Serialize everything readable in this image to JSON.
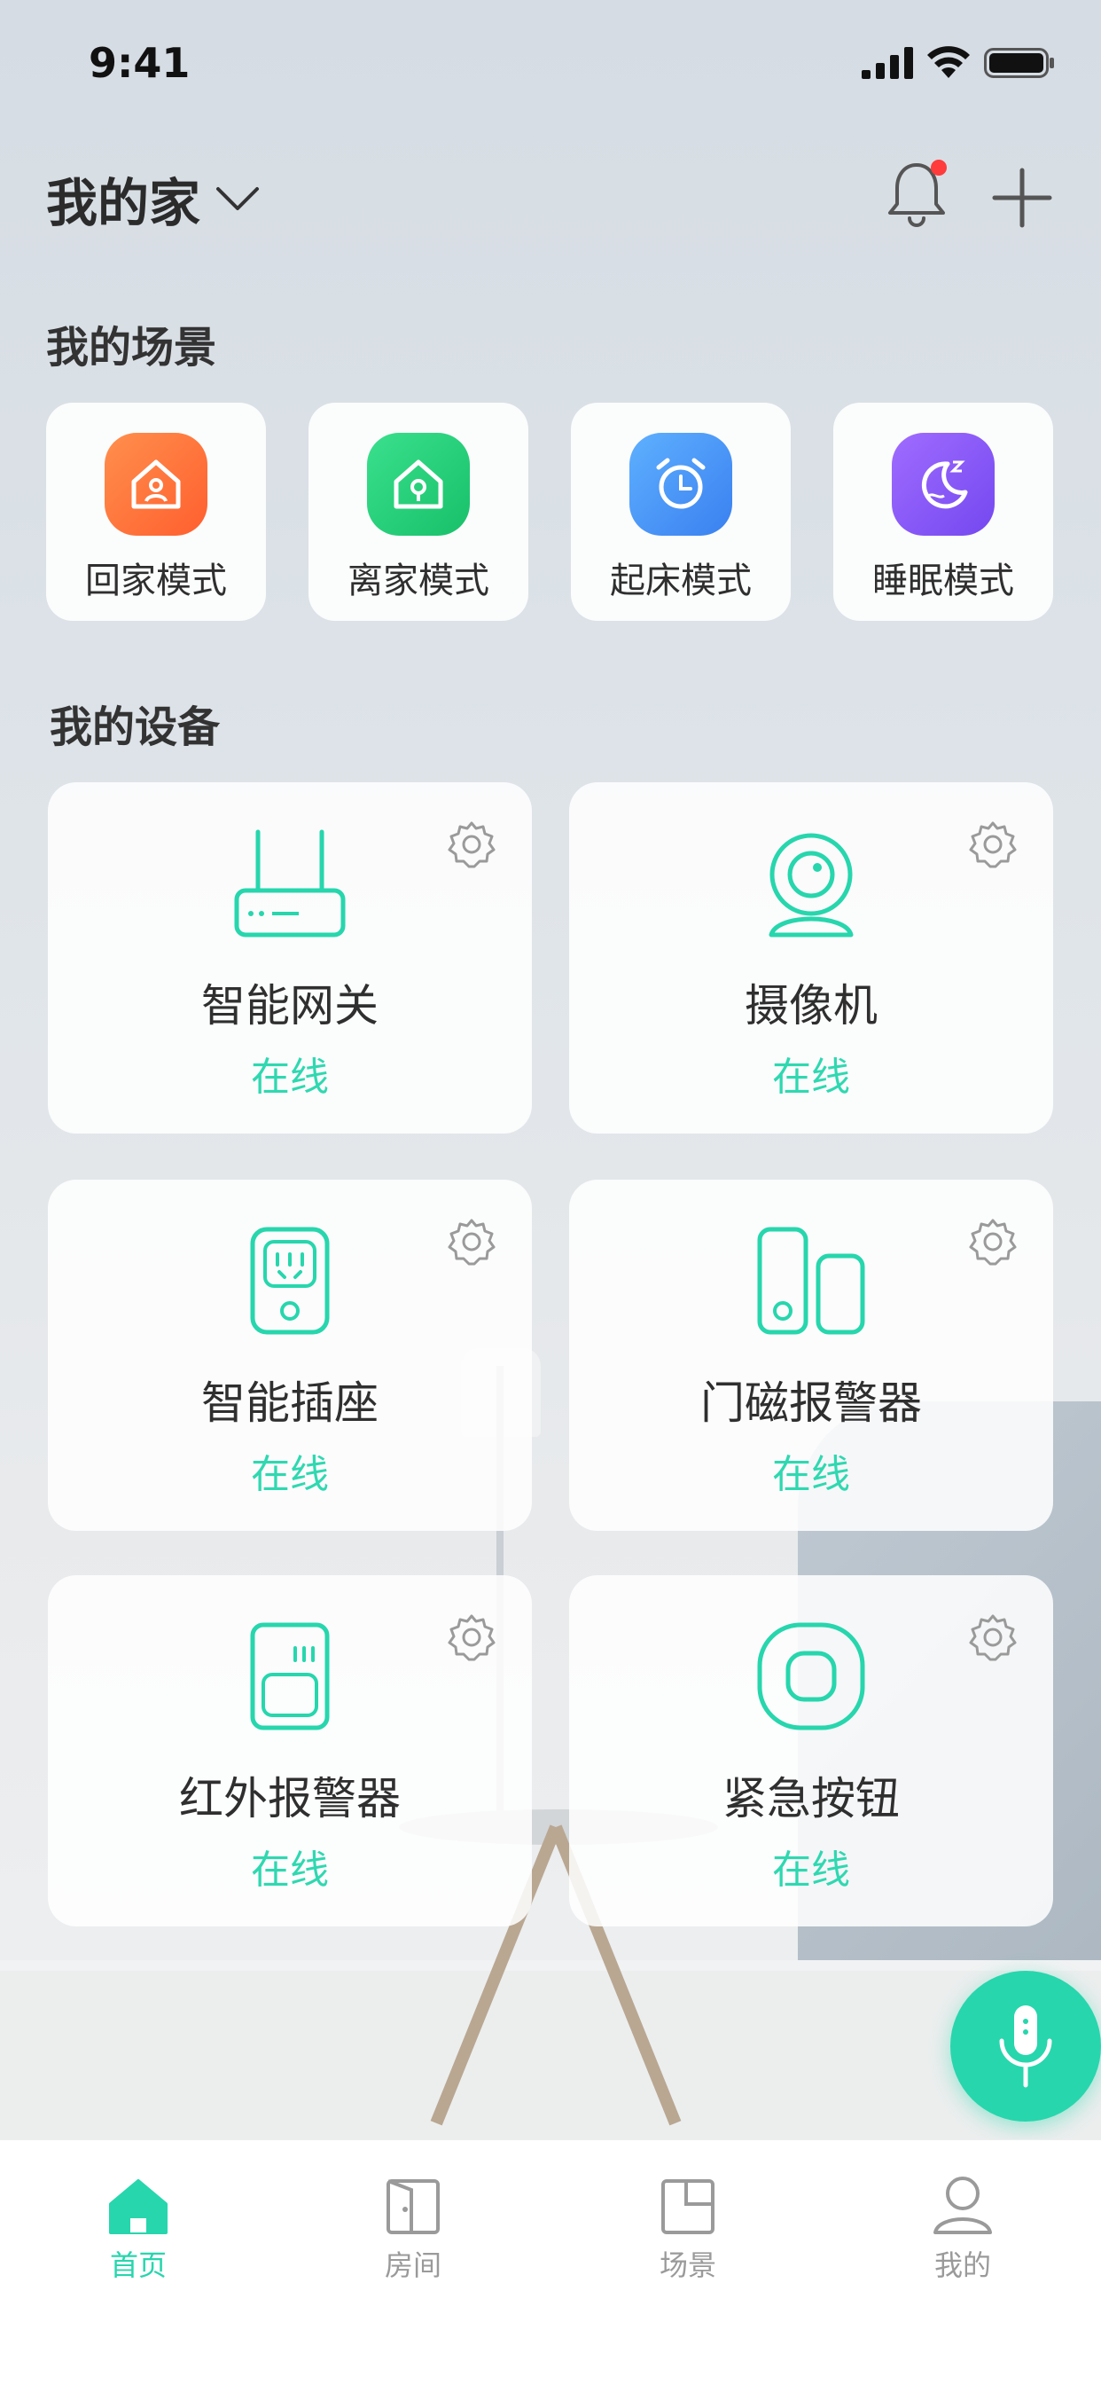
{
  "status_bar": {
    "time": "9:41"
  },
  "header": {
    "home_name": "我的家"
  },
  "sections": {
    "scenes_title": "我的场景",
    "devices_title": "我的设备"
  },
  "scenes": [
    {
      "label": "回家模式",
      "color": "#ff7a3d",
      "icon": "home-person-icon"
    },
    {
      "label": "离家模式",
      "color": "#2fd67f",
      "icon": "home-lock-icon"
    },
    {
      "label": "起床模式",
      "color": "#4b9cff",
      "icon": "alarm-clock-icon"
    },
    {
      "label": "睡眠模式",
      "color": "#8a5cff",
      "icon": "moon-sleep-icon"
    }
  ],
  "devices": [
    {
      "name": "智能网关",
      "status": "在线",
      "icon": "router-icon"
    },
    {
      "name": "摄像机",
      "status": "在线",
      "icon": "camera-icon"
    },
    {
      "name": "智能插座",
      "status": "在线",
      "icon": "socket-icon"
    },
    {
      "name": "门磁报警器",
      "status": "在线",
      "icon": "door-sensor-icon"
    },
    {
      "name": "红外报警器",
      "status": "在线",
      "icon": "infrared-sensor-icon"
    },
    {
      "name": "紧急按钮",
      "status": "在线",
      "icon": "emergency-button-icon"
    }
  ],
  "tabs": [
    {
      "label": "首页",
      "icon": "home-icon",
      "active": true
    },
    {
      "label": "房间",
      "icon": "door-icon",
      "active": false
    },
    {
      "label": "场景",
      "icon": "scene-icon",
      "active": false
    },
    {
      "label": "我的",
      "icon": "user-icon",
      "active": false
    }
  ],
  "colors": {
    "accent": "#27d6ad",
    "online": "#2fd8b0",
    "notification_dot": "#ff3b3b"
  }
}
